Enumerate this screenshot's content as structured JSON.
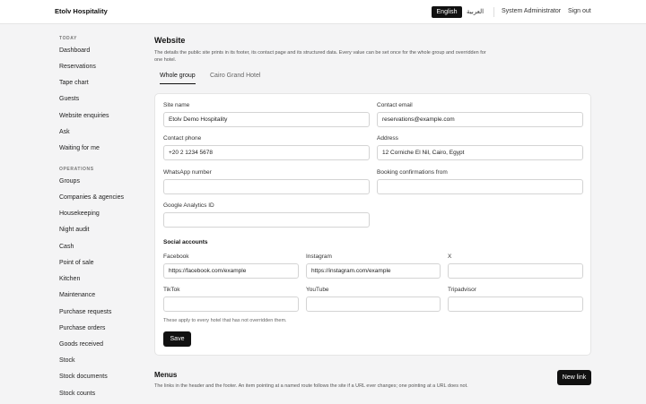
{
  "header": {
    "brand": "Etolv Hospitality",
    "lang_en": "English",
    "lang_ar": "العربية",
    "user": "System Administrator",
    "sign_out": "Sign out"
  },
  "sidebar": {
    "today_label": "TODAY",
    "today_items": [
      "Dashboard",
      "Reservations",
      "Tape chart",
      "Guests",
      "Website enquiries",
      "Ask",
      "Waiting for me"
    ],
    "operations_label": "OPERATIONS",
    "operations_items": [
      "Groups",
      "Companies & agencies",
      "Housekeeping",
      "Night audit",
      "Cash",
      "Point of sale",
      "Kitchen",
      "Maintenance",
      "Purchase requests",
      "Purchase orders",
      "Goods received",
      "Stock",
      "Stock documents",
      "Stock counts"
    ]
  },
  "main": {
    "title": "Website",
    "description": "The details the public site prints in its footer, its contact page and its structured data. Every value can be set once for the whole group and overridden for one hotel.",
    "tabs": [
      "Whole group",
      "Cairo Grand Hotel"
    ],
    "fields": {
      "site_name": {
        "label": "Site name",
        "value": "Etolv Demo Hospitality"
      },
      "contact_email": {
        "label": "Contact email",
        "value": "reservations@example.com"
      },
      "contact_phone": {
        "label": "Contact phone",
        "value": "+20 2 1234 5678"
      },
      "address": {
        "label": "Address",
        "value": "12 Corniche El Nil, Cairo, Egypt"
      },
      "whatsapp": {
        "label": "WhatsApp number",
        "value": ""
      },
      "booking_confirmations_from": {
        "label": "Booking confirmations from",
        "value": ""
      },
      "google_analytics": {
        "label": "Google Analytics ID",
        "value": ""
      }
    },
    "social": {
      "title": "Social accounts",
      "facebook": {
        "label": "Facebook",
        "value": "https://facebook.com/example"
      },
      "instagram": {
        "label": "Instagram",
        "value": "https://instagram.com/example"
      },
      "x": {
        "label": "X",
        "value": ""
      },
      "tiktok": {
        "label": "TikTok",
        "value": ""
      },
      "youtube": {
        "label": "YouTube",
        "value": ""
      },
      "tripadvisor": {
        "label": "Tripadvisor",
        "value": ""
      }
    },
    "hint": "These apply to every hotel that has not overridden them.",
    "save_label": "Save"
  },
  "menus": {
    "title": "Menus",
    "description": "The links in the header and the footer. An item pointing at a named route follows the site if a URL ever changes; one pointing at a URL does not.",
    "new_link_label": "New link"
  }
}
